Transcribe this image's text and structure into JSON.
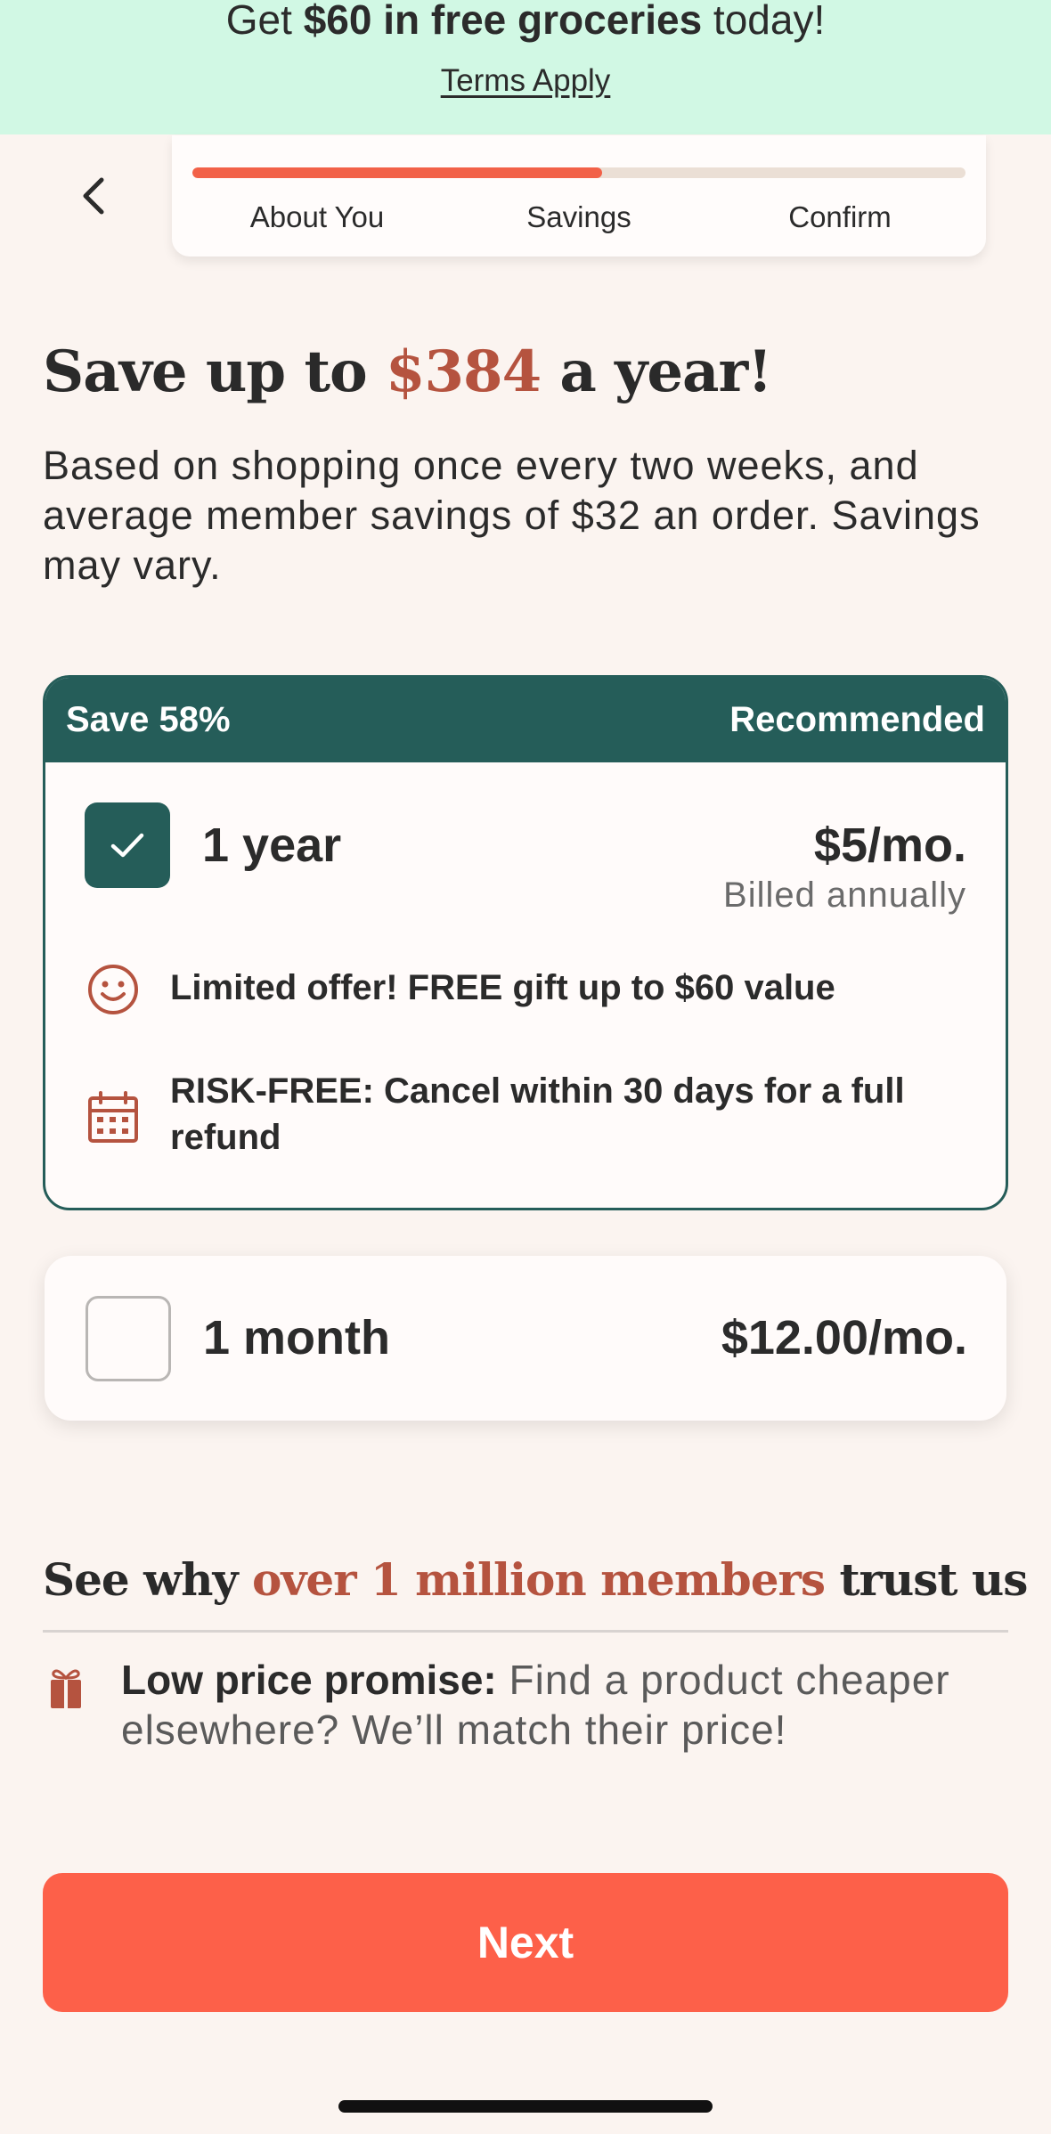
{
  "banner": {
    "prefix": "Get ",
    "highlight": "$60 in free groceries",
    "suffix": " today!",
    "terms": "Terms Apply"
  },
  "progress": {
    "fill_percent": 53,
    "steps": [
      "About You",
      "Savings",
      "Confirm"
    ],
    "fill_color": "#f26148"
  },
  "headline": {
    "prefix": "Save up to ",
    "amount": "$384",
    "suffix": " a year!"
  },
  "subtext": "Based on shopping once every two weeks, and average member savings of $32 an order. Savings may vary.",
  "plans": {
    "annual": {
      "save_label": "Save 58%",
      "badge": "Recommended",
      "name": "1 year",
      "price": "$5/mo.",
      "billing": "Billed annually",
      "checked": true,
      "features": [
        {
          "icon": "smile-icon",
          "text": "Limited offer! FREE gift up to $60 value"
        },
        {
          "icon": "calendar-icon",
          "text": "RISK-FREE: Cancel within 30 days for a full refund"
        }
      ]
    },
    "monthly": {
      "name": "1 month",
      "price": "$12.00/mo.",
      "checked": false
    }
  },
  "trust": {
    "prefix": "See why ",
    "highlight": "over 1 million members",
    "suffix": " trust us",
    "promise_title": "Low price promise:",
    "promise_text": " Find a product cheaper elsewhere? We’ll match their price!",
    "promise_icon": "gift-icon"
  },
  "next_button": "Next",
  "colors": {
    "banner_bg": "#d1f8e4",
    "primary_green": "#255d59",
    "accent_red": "#b5533f",
    "cta": "#fd6049",
    "page_bg": "#fbf4f0"
  }
}
